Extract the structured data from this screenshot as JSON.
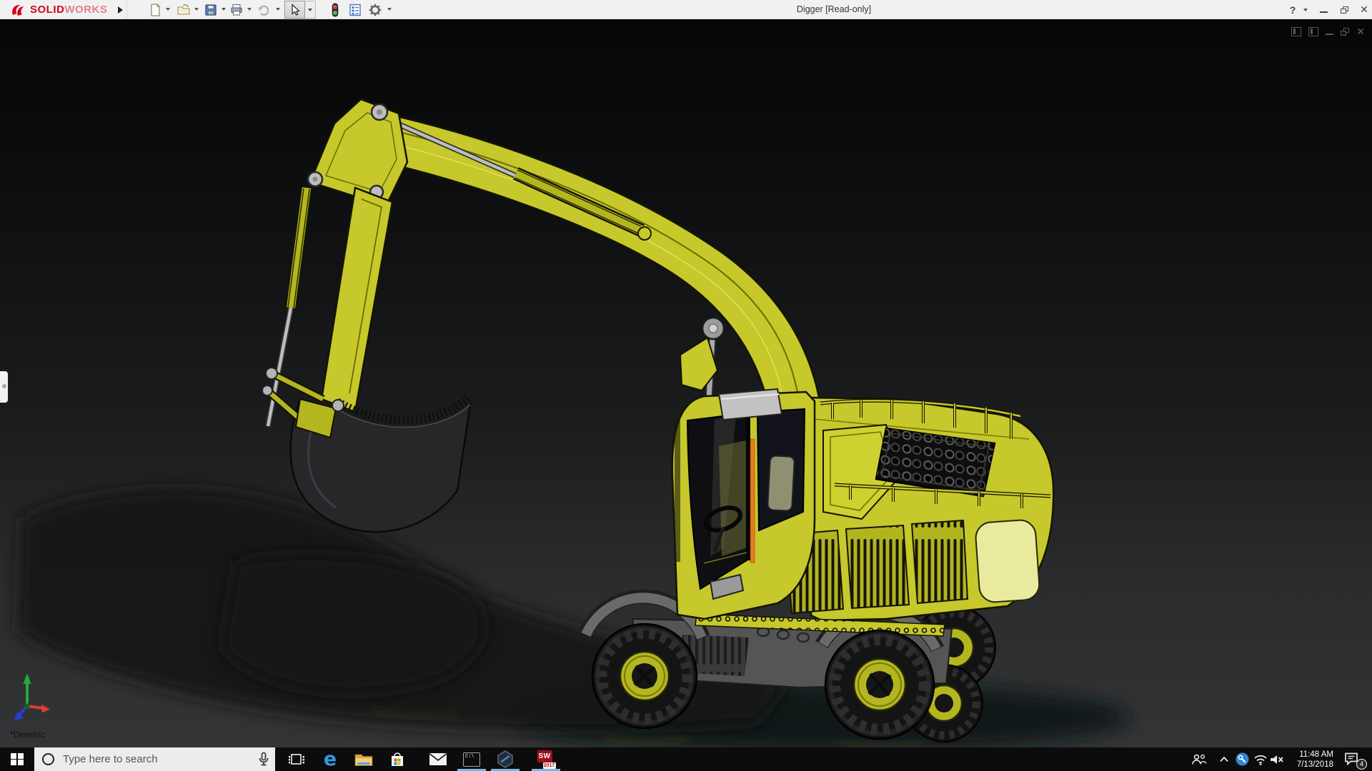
{
  "titlebar": {
    "brand": {
      "bold": "SOLID",
      "light": "WORKS"
    },
    "document_title": "Digger [Read-only]",
    "help_label": "?",
    "toolbar": [
      {
        "icon": "new-document-icon",
        "dropdown": true
      },
      {
        "icon": "open-icon",
        "dropdown": true
      },
      {
        "icon": "save-icon",
        "dropdown": true
      },
      {
        "icon": "print-icon",
        "dropdown": true
      },
      {
        "icon": "undo-icon",
        "dropdown": true,
        "state": "disabled"
      },
      {
        "icon": "select-cursor-icon",
        "dropdown": true,
        "state": "active"
      },
      {
        "icon": "rebuild-traffic-light-icon"
      },
      {
        "icon": "file-properties-icon"
      },
      {
        "icon": "options-gear-icon",
        "dropdown": true
      }
    ],
    "window_controls": [
      "help",
      "minimize",
      "restore",
      "close"
    ]
  },
  "viewport": {
    "view_orientation": "*Dimetric",
    "model": "digger-excavator",
    "colors": {
      "body_yellow": "#c6c82b",
      "accent_orange": "#e87a1e",
      "triad_x_red": "#e03c31",
      "triad_y_green": "#28a83c",
      "triad_z_blue": "#2b3fd0"
    },
    "mdi_controls": [
      "toggle-pane",
      "toggle-pane",
      "minimize",
      "restore",
      "close"
    ]
  },
  "taskbar": {
    "search_placeholder": "Type here to search",
    "apps": [
      {
        "name": "task-view"
      },
      {
        "name": "microsoft-edge",
        "glyph": "e"
      },
      {
        "name": "file-explorer"
      },
      {
        "name": "microsoft-store"
      },
      {
        "name": "mail"
      },
      {
        "name": "command-prompt",
        "glyph": "C:\\",
        "running": true
      },
      {
        "name": "hexagon-3d-app",
        "running": true
      },
      {
        "name": "solidworks-2017",
        "glyph_top": "SW",
        "glyph_year": "2017",
        "running": true
      }
    ],
    "tray": {
      "icons": [
        "people",
        "hidden-icons-chevron",
        "blue-key",
        "wifi",
        "volume-muted"
      ],
      "time": "11:48 AM",
      "date": "7/13/2018",
      "notification_count": "4"
    }
  }
}
